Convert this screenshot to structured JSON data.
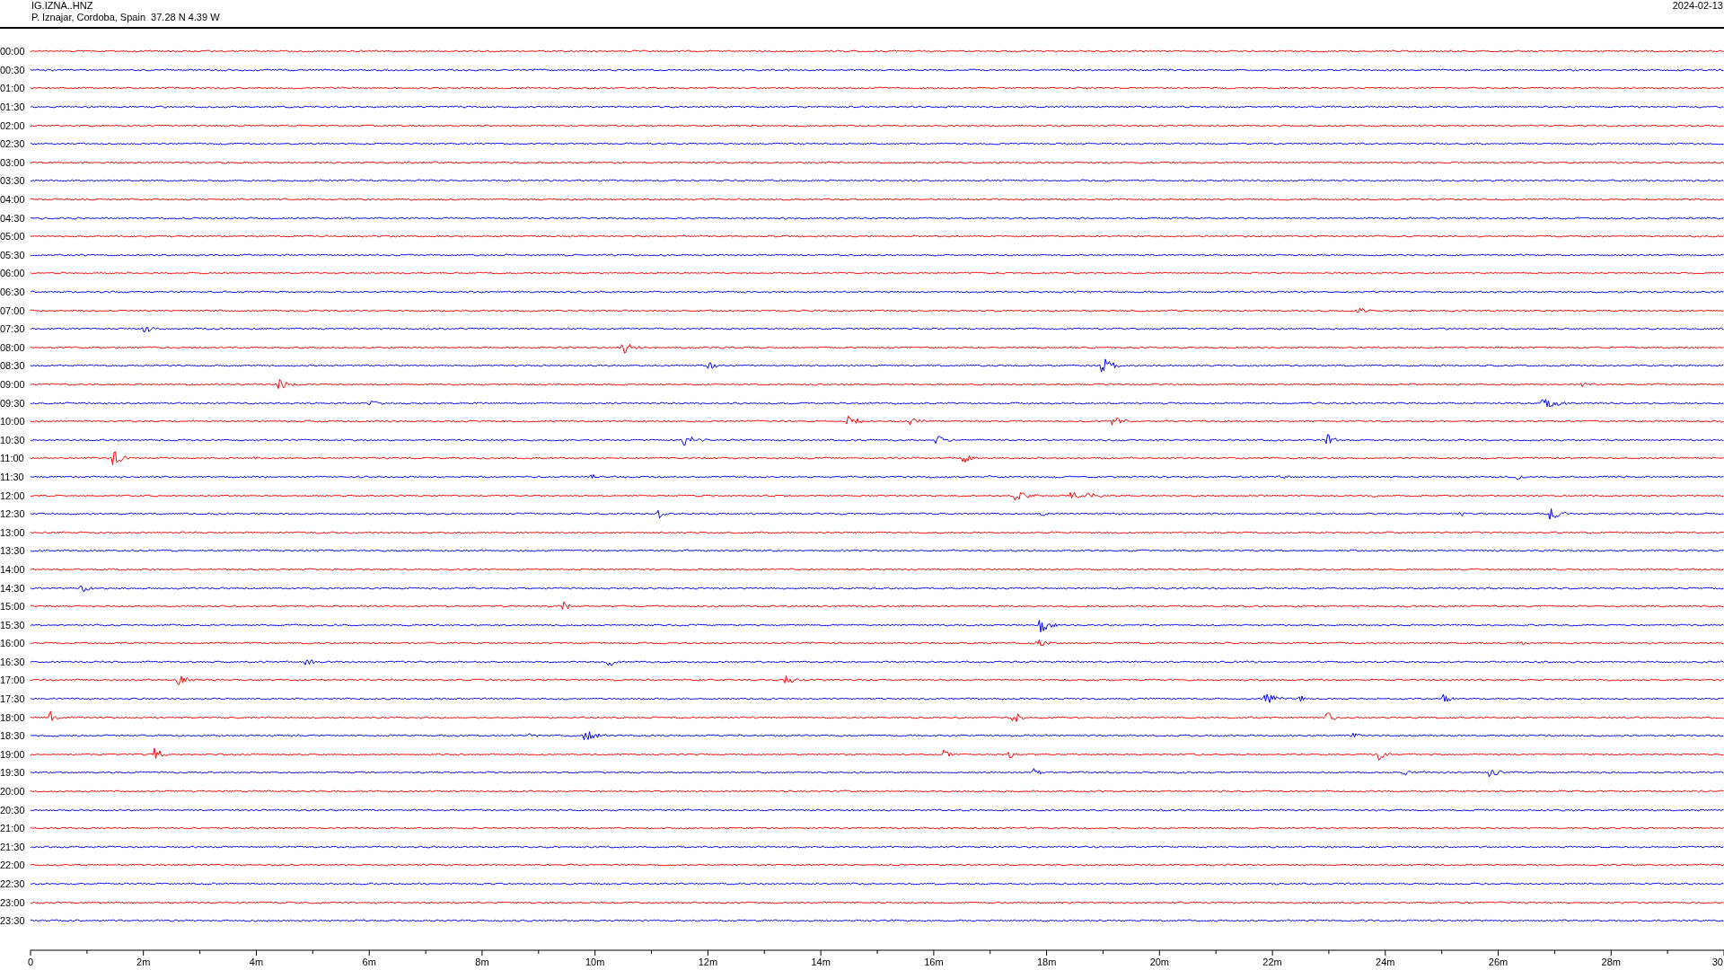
{
  "header": {
    "station": "IG.IZNA..HNZ",
    "location": "P. Iznajar, Cordoba, Spain  37.28 N 4.39 W",
    "date": "2024-02-13"
  },
  "traces": [
    {
      "time": "00:00",
      "color": "#ff0000"
    },
    {
      "time": "00:30",
      "color": "#0000ff"
    },
    {
      "time": "01:00",
      "color": "#ff0000"
    },
    {
      "time": "01:30",
      "color": "#0000ff"
    },
    {
      "time": "02:00",
      "color": "#ff0000"
    },
    {
      "time": "02:30",
      "color": "#0000ff"
    },
    {
      "time": "03:00",
      "color": "#ff0000"
    },
    {
      "time": "03:30",
      "color": "#0000ff"
    },
    {
      "time": "04:00",
      "color": "#ff0000"
    },
    {
      "time": "04:30",
      "color": "#0000ff"
    },
    {
      "time": "05:00",
      "color": "#ff0000"
    },
    {
      "time": "05:30",
      "color": "#0000ff"
    },
    {
      "time": "06:00",
      "color": "#ff0000"
    },
    {
      "time": "06:30",
      "color": "#0000ff"
    },
    {
      "time": "07:00",
      "color": "#ff0000"
    },
    {
      "time": "07:30",
      "color": "#0000ff"
    },
    {
      "time": "08:00",
      "color": "#ff0000"
    },
    {
      "time": "08:30",
      "color": "#0000ff"
    },
    {
      "time": "09:00",
      "color": "#ff0000"
    },
    {
      "time": "09:30",
      "color": "#0000ff"
    },
    {
      "time": "10:00",
      "color": "#ff0000"
    },
    {
      "time": "10:30",
      "color": "#0000ff"
    },
    {
      "time": "11:00",
      "color": "#ff0000"
    },
    {
      "time": "11:30",
      "color": "#0000ff"
    },
    {
      "time": "12:00",
      "color": "#ff0000"
    },
    {
      "time": "12:30",
      "color": "#0000ff"
    },
    {
      "time": "13:00",
      "color": "#ff0000"
    },
    {
      "time": "13:30",
      "color": "#0000ff"
    },
    {
      "time": "14:00",
      "color": "#ff0000"
    },
    {
      "time": "14:30",
      "color": "#0000ff"
    },
    {
      "time": "15:00",
      "color": "#ff0000"
    },
    {
      "time": "15:30",
      "color": "#0000ff"
    },
    {
      "time": "16:00",
      "color": "#ff0000"
    },
    {
      "time": "16:30",
      "color": "#0000ff"
    },
    {
      "time": "17:00",
      "color": "#ff0000"
    },
    {
      "time": "17:30",
      "color": "#0000ff"
    },
    {
      "time": "18:00",
      "color": "#ff0000"
    },
    {
      "time": "18:30",
      "color": "#0000ff"
    },
    {
      "time": "19:00",
      "color": "#ff0000"
    },
    {
      "time": "19:30",
      "color": "#0000ff"
    },
    {
      "time": "20:00",
      "color": "#ff0000"
    },
    {
      "time": "20:30",
      "color": "#0000ff"
    },
    {
      "time": "21:00",
      "color": "#ff0000"
    },
    {
      "time": "21:30",
      "color": "#0000ff"
    },
    {
      "time": "22:00",
      "color": "#ff0000"
    },
    {
      "time": "22:30",
      "color": "#0000ff"
    },
    {
      "time": "23:00",
      "color": "#ff0000"
    },
    {
      "time": "23:30",
      "color": "#0000ff"
    }
  ],
  "x_axis": {
    "ticks": [
      "0",
      "2m",
      "4m",
      "6m",
      "8m",
      "10m",
      "12m",
      "14m",
      "16m",
      "18m",
      "20m",
      "22m",
      "24m",
      "26m",
      "28m",
      "30"
    ]
  }
}
